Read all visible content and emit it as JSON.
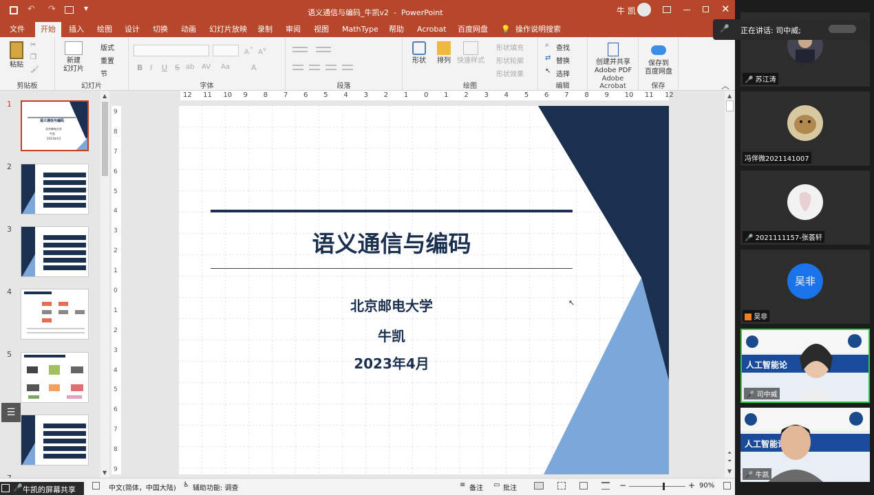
{
  "window": {
    "title": "语义通信与编码_牛凯v2  -  PowerPoint",
    "user": "牛 凯"
  },
  "tabs": [
    "文件",
    "开始",
    "插入",
    "绘图",
    "设计",
    "切换",
    "动画",
    "幻灯片放映",
    "录制",
    "审阅",
    "视图",
    "MathType",
    "帮助",
    "Acrobat",
    "百度网盘"
  ],
  "tell_me": "操作说明搜索",
  "ribbon": {
    "clipboard": {
      "label": "剪贴板",
      "paste": "粘贴"
    },
    "slides": {
      "label": "幻灯片",
      "new_slide_1": "新建",
      "new_slide_2": "幻灯片",
      "layout": "版式",
      "reset": "重置",
      "section": "节"
    },
    "font": {
      "label": "字体",
      "buttons": [
        "B",
        "I",
        "U",
        "S",
        "ab",
        "AV",
        "Aa",
        "A"
      ]
    },
    "paragraph": {
      "label": "段落"
    },
    "drawing": {
      "label": "绘图",
      "shapes": "形状",
      "arrange": "排列",
      "quick_styles": "快速样式",
      "fill": "形状填充",
      "outline": "形状轮廓",
      "effect": "形状效果"
    },
    "editing": {
      "label": "编辑",
      "find": "查找",
      "replace": "替换",
      "select": "选择"
    },
    "acrobat": {
      "label": "Adobe Acrobat",
      "create_1": "创建并共享",
      "create_2": "Adobe PDF"
    },
    "save": {
      "label": "保存",
      "save_1": "保存到",
      "save_2": "百度网盘"
    }
  },
  "rulers": {
    "h_ticks": [
      "12",
      "11",
      "10",
      "9",
      "8",
      "7",
      "6",
      "5",
      "4",
      "3",
      "2",
      "1",
      "0",
      "1",
      "2",
      "3",
      "4",
      "5",
      "6",
      "7",
      "8",
      "9",
      "10",
      "11",
      "12"
    ],
    "v_ticks": [
      "9",
      "8",
      "7",
      "6",
      "5",
      "4",
      "3",
      "2",
      "1",
      "0",
      "1",
      "2",
      "3",
      "4",
      "5",
      "6",
      "7",
      "8",
      "9"
    ]
  },
  "thumbnails": [
    {
      "num": "1",
      "title": "语义通信与编码",
      "sub1": "北京邮电大学",
      "sub2": "牛凯",
      "sub3": "2023年4月"
    },
    {
      "num": "2"
    },
    {
      "num": "3"
    },
    {
      "num": "4"
    },
    {
      "num": "5"
    },
    {
      "num": "6"
    },
    {
      "num": "7"
    }
  ],
  "slide": {
    "title": "语义通信与编码",
    "org": "北京邮电大学",
    "author": "牛凯",
    "date": "2023年4月"
  },
  "status": {
    "language": "中文(简体，中国大陆)",
    "accessibility": "辅助功能: 调查",
    "notes": "备注",
    "comments": "批注",
    "zoom": "90%",
    "zoom_level": 0.6
  },
  "meeting": {
    "speaking_label": "正在讲话: 司中威;",
    "share_label": "牛凯的屏幕共享",
    "participants": [
      {
        "name": "苏江涛"
      },
      {
        "name": "冯伴微2021141007"
      },
      {
        "name": "2021111157-张荟轩"
      },
      {
        "name": "吴非",
        "initials": "吴非"
      },
      {
        "name": "司中威",
        "banner": "人工智能论"
      },
      {
        "name": "牛凯",
        "banner": "人工智能论"
      }
    ]
  },
  "colors": {
    "accent": "#b7472a",
    "navy": "#1b2f4e",
    "lightblue": "#7ba7db",
    "avatar_blue": "#1a73e8"
  }
}
